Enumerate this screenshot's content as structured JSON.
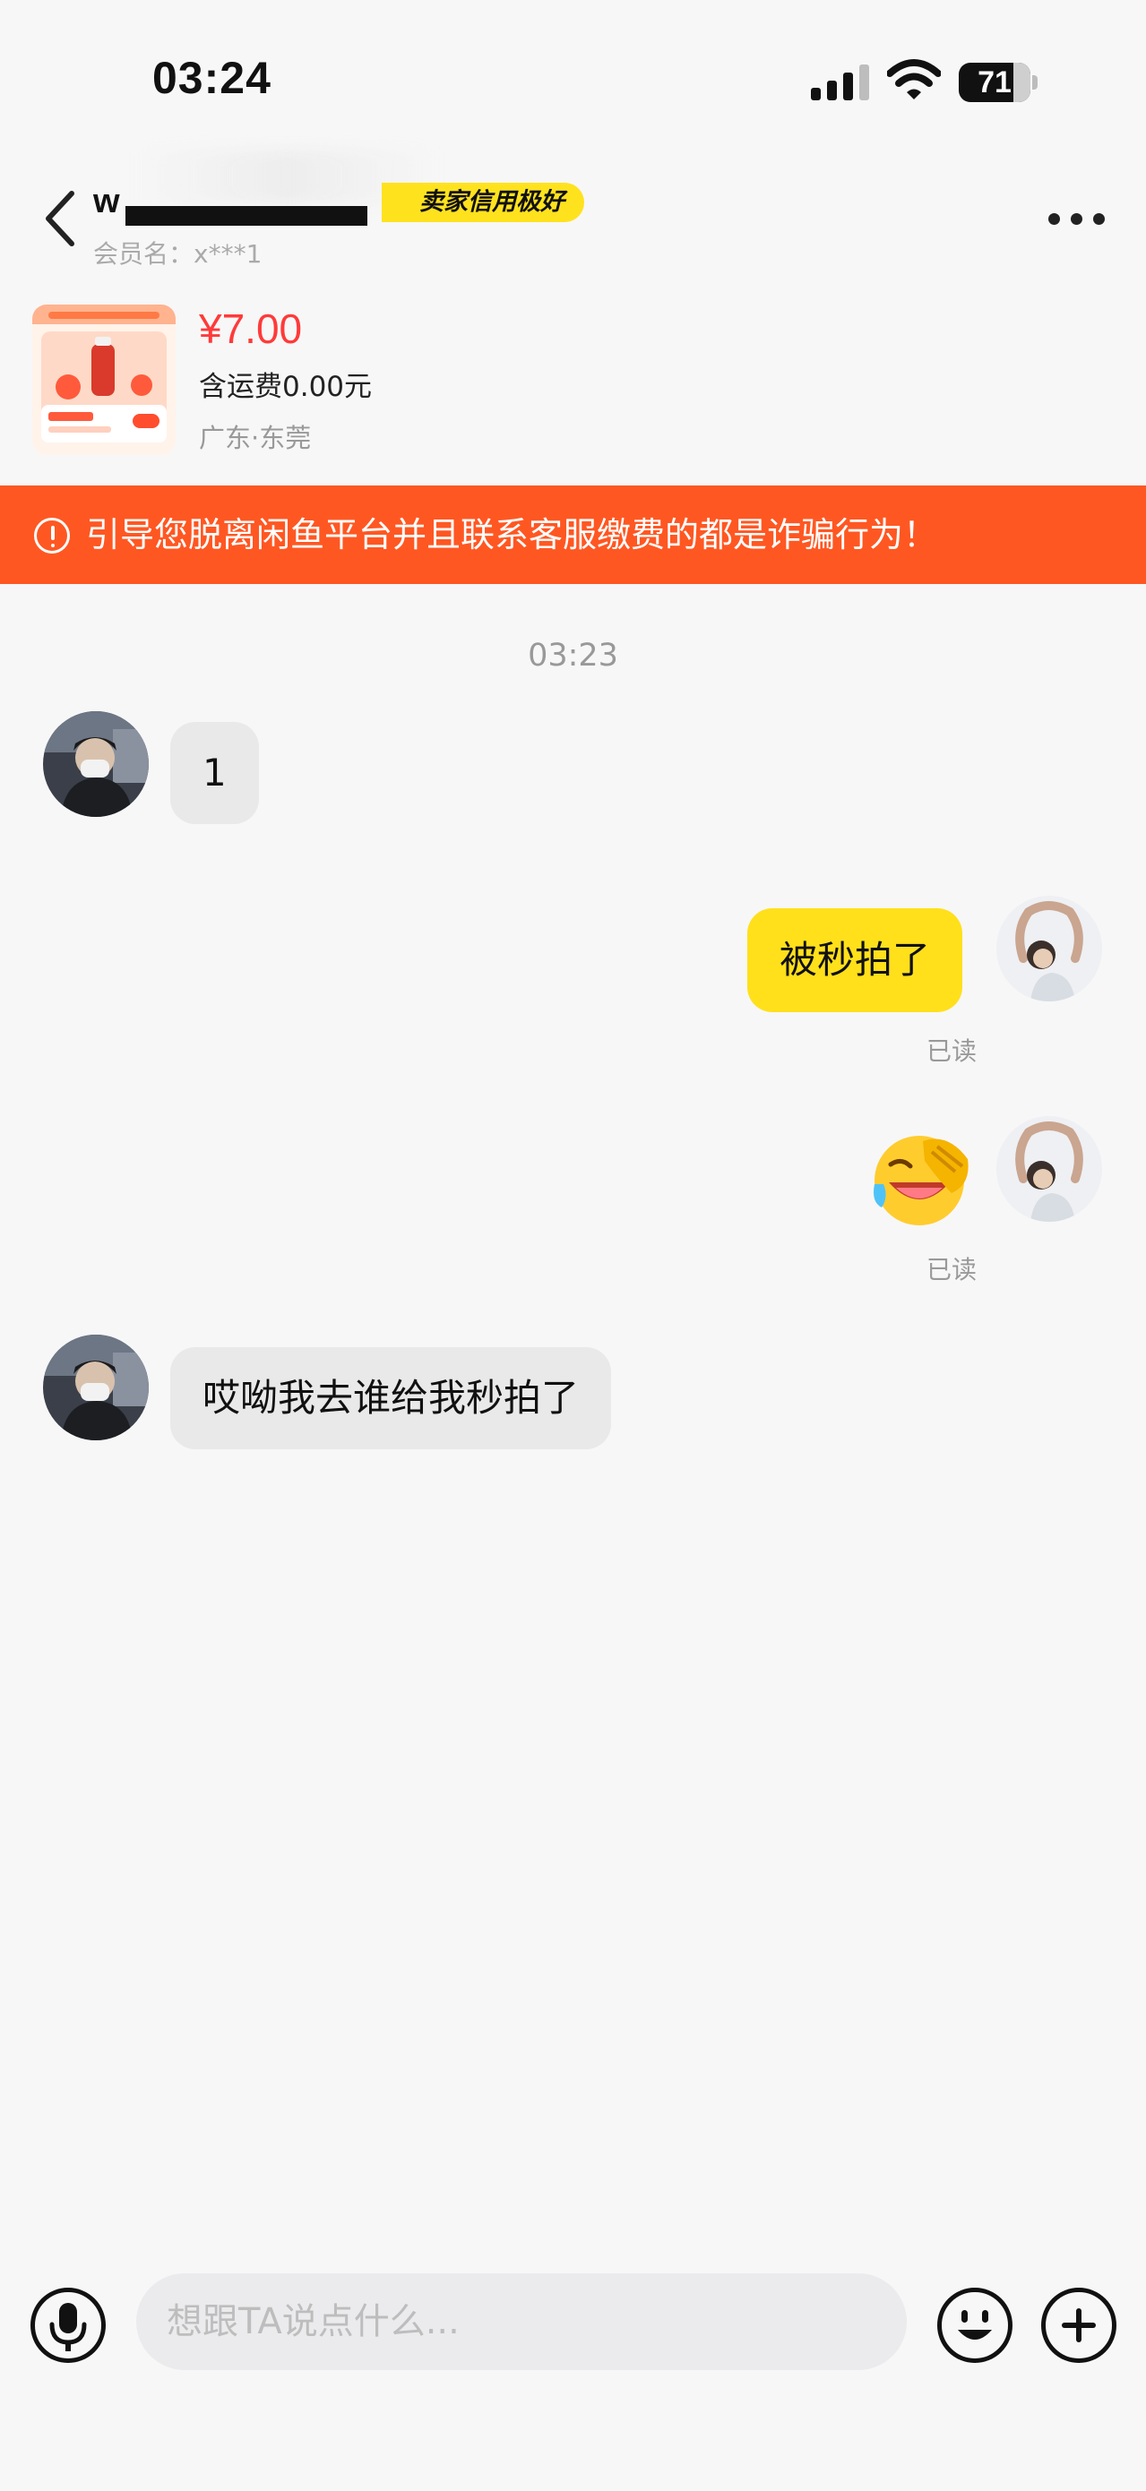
{
  "status_bar": {
    "time": "03:24",
    "battery": "71"
  },
  "header": {
    "seller_name": "w",
    "credit_badge": "卖家信用极好",
    "member_label": "会员名：x***1"
  },
  "product": {
    "price": "¥7.00",
    "shipping": "含运费0.00元",
    "location": "广东·东莞"
  },
  "warning": {
    "text": "引导您脱离闲鱼平台并且联系客服缴费的都是诈骗行为！"
  },
  "chat": {
    "timestamp": "03:23",
    "messages": [
      {
        "from": "seller",
        "text": "1"
      },
      {
        "from": "me",
        "text": "被秒拍了",
        "status": "已读"
      },
      {
        "from": "me",
        "emoji": "crying-laughing-emoji",
        "status": "已读"
      },
      {
        "from": "seller",
        "text": "哎呦我去谁给我秒拍了"
      }
    ]
  },
  "input_bar": {
    "placeholder": "想跟TA说点什么..."
  },
  "colors": {
    "accent_yellow": "#ffe01b",
    "warning_orange": "#ff5722",
    "price_red": "#ff3a3a"
  }
}
